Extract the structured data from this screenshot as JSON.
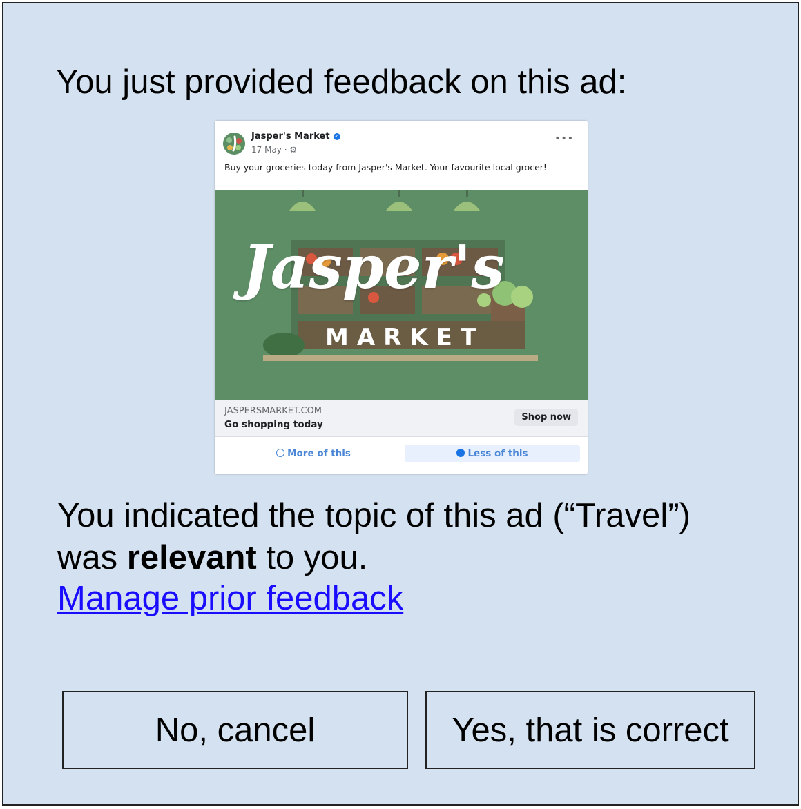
{
  "dialog": {
    "heading": "You just provided feedback on this ad:",
    "feedback_prefix": "You indicated the topic of this ad (“Travel”) was ",
    "feedback_bold": "relevant",
    "feedback_suffix": " to you.",
    "manage_link": "Manage prior feedback",
    "cancel_label": "No, cancel",
    "confirm_label": "Yes, that is correct"
  },
  "ad": {
    "advertiser": "Jasper's Market",
    "date": "17 May · ⚙",
    "body": "Buy your groceries today from Jasper's Market. Your favourite local grocer!",
    "image_logo_script": "Jasper's",
    "image_logo_sub": "MARKET",
    "domain": "JASPERSMARKET.COM",
    "headline": "Go shopping today",
    "cta": "Shop now",
    "more_of_this": "More of this",
    "less_of_this": "Less of this"
  },
  "icons": {
    "verified": "verified-badge-icon",
    "more": "more-options-icon",
    "more_of_this": "smile-icon",
    "less_of_this": "frown-icon"
  },
  "colors": {
    "panel_bg": "#d4e1f0",
    "link": "#1a0dff",
    "ad_image_bg": "#5e8e66",
    "fb_blue": "#1b74e4"
  }
}
